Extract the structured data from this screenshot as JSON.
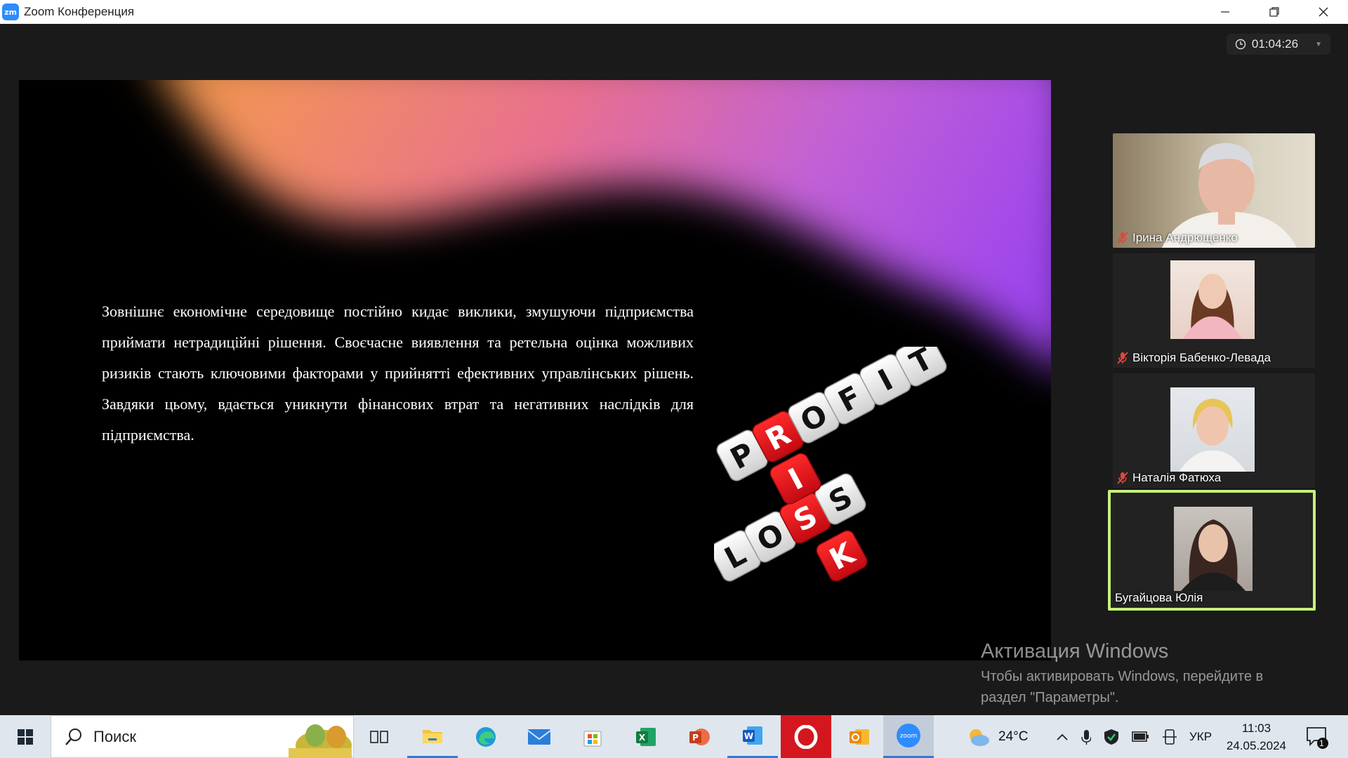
{
  "window": {
    "app_logo": "zm",
    "title": "Zoom Конференция"
  },
  "meeting": {
    "elapsed_time": "01:04:26"
  },
  "slide": {
    "body_text": "Зовнішнє економічне середовище постійно кидає виклики, змушуючи підприємства приймати нетрадиційні рішення. Своєчасне виявлення та ретельна оцінка можливих ризиків стають ключовими факторами у прийнятті ефективних управлінських рішень. Завдяки цьому, вдається уникнути фінансових втрат та негативних наслідків для підприємства.",
    "dice_words": {
      "profit": [
        "P",
        "R",
        "O",
        "F",
        "I",
        "T"
      ],
      "loss": [
        "L",
        "O",
        "S",
        "S"
      ],
      "risk_extra": [
        "K"
      ]
    },
    "colors": {
      "dice_red": "#e8121c",
      "dice_white": "#f4f4f4"
    }
  },
  "participants": [
    {
      "name": "Ірина Андрющенко",
      "muted": true
    },
    {
      "name": "Вікторія Бабенко-Левада",
      "muted": true
    },
    {
      "name": "Наталія Фатюха",
      "muted": true
    },
    {
      "name": "Бугайцова Юлія",
      "muted": false,
      "active_speaker": true
    }
  ],
  "activation": {
    "title": "Активация Windows",
    "message": "Чтобы активировать Windows, перейдите в раздел \"Параметры\"."
  },
  "taskbar": {
    "search_placeholder": "Поиск",
    "apps": [
      "task-view",
      "file-explorer",
      "edge",
      "mail",
      "store",
      "excel",
      "powerpoint",
      "word",
      "opera",
      "outlook",
      "zoom"
    ],
    "zoom_label": "zoom",
    "weather": "24°C",
    "language": "УКР",
    "time": "11:03",
    "date": "24.05.2024",
    "notifications": "1",
    "accent": "#2f7cd6"
  }
}
